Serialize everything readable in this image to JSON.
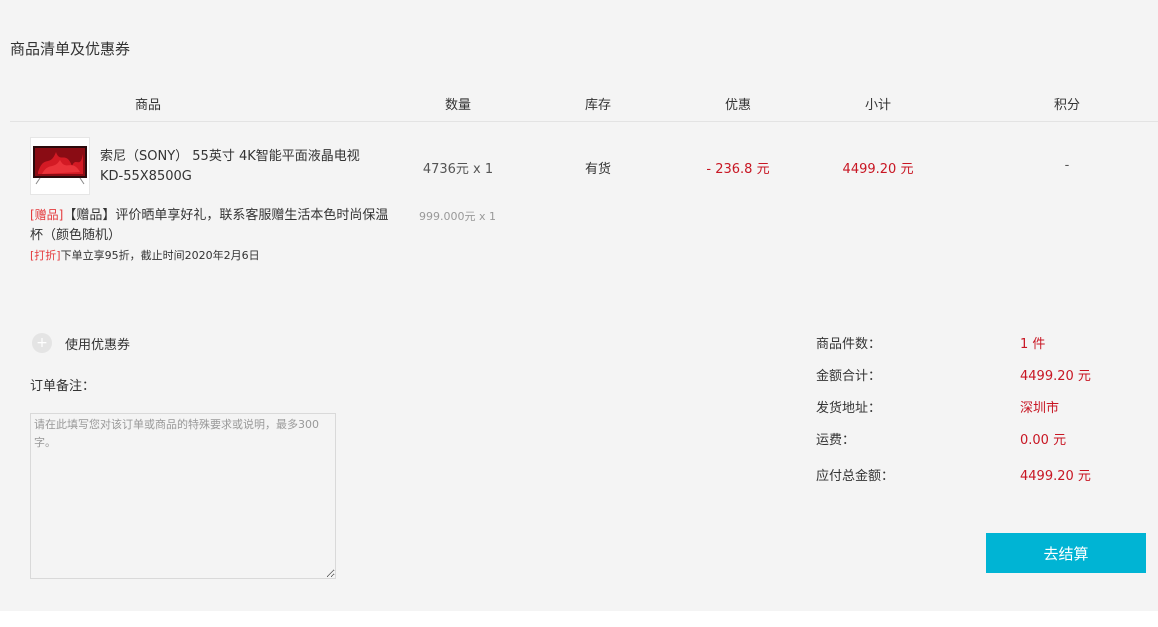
{
  "section_title": "商品清单及优惠券",
  "table": {
    "headers": [
      "商品",
      "数量",
      "库存",
      "优惠",
      "小计",
      "积分"
    ]
  },
  "item": {
    "name": "索尼（SONY） 55英寸 4K智能平面液晶电视 KD-55X8500G",
    "quantity": "4736元 x 1",
    "stock": "有货",
    "discount": "- 236.8 元",
    "subtotal": "4499.20 元",
    "points": "-",
    "gift": {
      "tag": "[赠品]",
      "text": "【赠品】评价晒单享好礼，联系客服赠生活本色时尚保温杯（颜色随机）",
      "quantity": "999.000元 x 1"
    },
    "promo": {
      "tag": "[打折]",
      "text": "下单立享95折，截止时间2020年2月6日"
    }
  },
  "coupon": {
    "label": "使用优惠券"
  },
  "notes": {
    "label": "订单备注：",
    "placeholder": "请在此填写您对该订单或商品的特殊要求或说明，最多300字。"
  },
  "summary": [
    {
      "label": "商品件数：",
      "value": "1 件"
    },
    {
      "label": "金额合计：",
      "value": "4499.20 元"
    },
    {
      "label": "发货地址：",
      "value": "深圳市"
    },
    {
      "label": "运费：",
      "value": "0.00 元"
    },
    {
      "label": "应付总金额：",
      "value": "4499.20 元"
    }
  ],
  "checkout_button": "去结算",
  "colors": {
    "price_red": "#c81623",
    "tag_red": "#e4393c",
    "button_cyan": "#00b4d4"
  }
}
